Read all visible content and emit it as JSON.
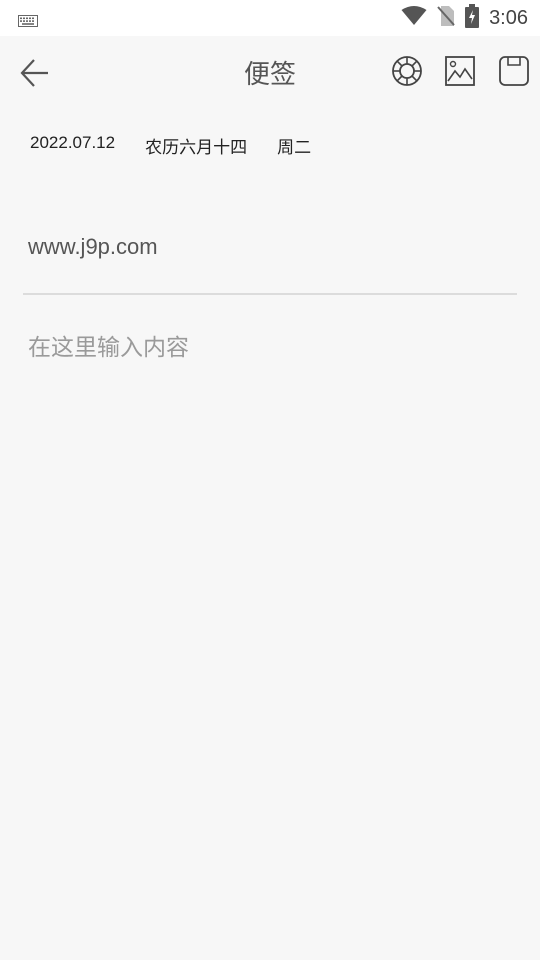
{
  "status_bar": {
    "keyboard_icon": "keyboard-icon",
    "wifi_icon": "wifi-icon",
    "sim_icon": "no-sim-icon",
    "battery_icon": "battery-charging-icon",
    "time": "3:06"
  },
  "toolbar": {
    "back_icon": "back-arrow-icon",
    "title": "便签",
    "palette_icon": "color-palette-icon",
    "image_icon": "image-icon",
    "save_icon": "save-icon"
  },
  "date_info": {
    "date": "2022.07.12",
    "lunar": "农历六月十四",
    "weekday": "周二"
  },
  "note": {
    "title_value": "www.j9p.com",
    "content_placeholder": "在这里输入内容"
  }
}
